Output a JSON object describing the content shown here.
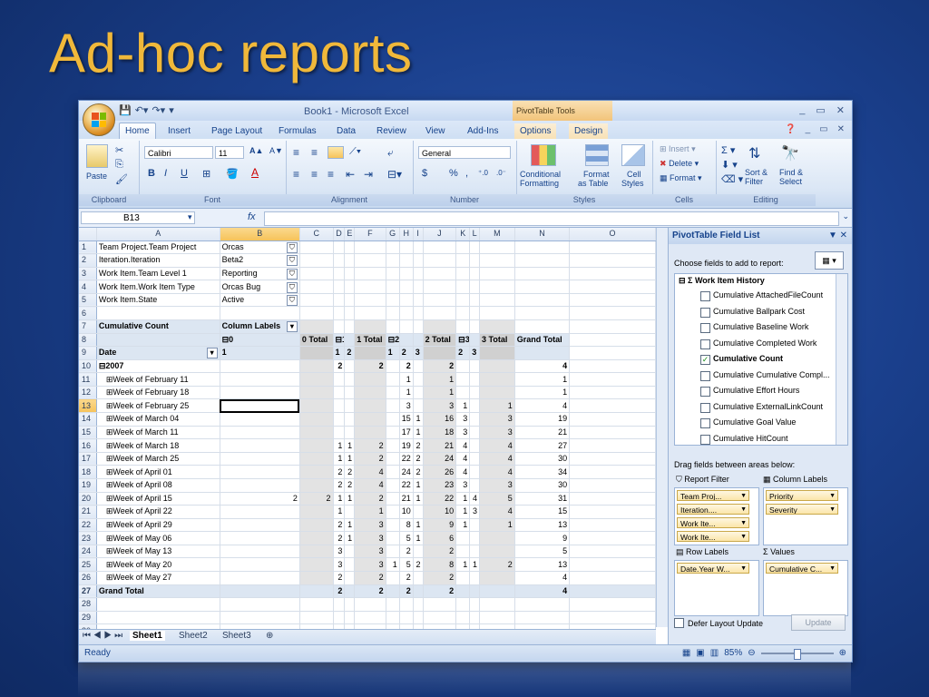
{
  "slide_title": "Ad-hoc reports",
  "window": {
    "title": "Book1 - Microsoft Excel",
    "context_tools": "PivotTable Tools",
    "controls": [
      "_",
      "▭",
      "✕"
    ]
  },
  "tabs": [
    "Home",
    "Insert",
    "Page Layout",
    "Formulas",
    "Data",
    "Review",
    "View",
    "Add-Ins",
    "Options",
    "Design"
  ],
  "ribbon": {
    "clipboard": {
      "label": "Clipboard",
      "paste": "Paste"
    },
    "font": {
      "label": "Font",
      "name": "Calibri",
      "size": "11",
      "bold": "B",
      "italic": "I",
      "underline": "U"
    },
    "alignment": {
      "label": "Alignment"
    },
    "number": {
      "label": "Number",
      "format": "General",
      "currency": "$",
      "percent": "%",
      "comma": ","
    },
    "styles": {
      "label": "Styles",
      "conditional": "Conditional",
      "conditional2": "Formatting",
      "format_table": "Format",
      "format_table2": "as Table",
      "cell_styles": "Cell",
      "cell_styles2": "Styles"
    },
    "cells": {
      "label": "Cells",
      "insert": "Insert",
      "delete": "Delete",
      "format": "Format"
    },
    "editing": {
      "label": "Editing",
      "sort": "Sort &",
      "sort2": "Filter",
      "find": "Find &",
      "find2": "Select"
    }
  },
  "formula_bar": {
    "name_box": "B13",
    "fx": "fx",
    "value": ""
  },
  "columns": [
    "",
    "A",
    "B",
    "C",
    "D",
    "E",
    "F",
    "G",
    "H",
    "I",
    "J",
    "K",
    "L",
    "M",
    "N",
    "O"
  ],
  "filters": [
    {
      "row": "1",
      "label": "Team Project.Team Project",
      "value": "Orcas"
    },
    {
      "row": "2",
      "label": "Iteration.Iteration",
      "value": "Beta2"
    },
    {
      "row": "3",
      "label": "Work Item.Team Level 1",
      "value": "Reporting"
    },
    {
      "row": "4",
      "label": "Work Item.Work Item Type",
      "value": "Orcas Bug"
    },
    {
      "row": "5",
      "label": "Work Item.State",
      "value": "Active"
    }
  ],
  "pivot": {
    "measure": "Cumulative Count",
    "column_labels": "Column Labels",
    "date_label": "Date",
    "p0": "⊟0",
    "p0_1": "1",
    "t0": "0 Total",
    "p1": "⊟1",
    "p1_1": "1",
    "p1_2": "2",
    "t1": "1 Total",
    "p2": "⊟2",
    "p2_1": "1",
    "p2_2": "2",
    "p2_3": "3",
    "t2": "2 Total",
    "p3": "⊟3",
    "p3_2": "2",
    "p3_3": "3",
    "t3": "3 Total",
    "grand": "Grand Total",
    "year": "⊟2007",
    "year_vals": {
      "D": "2",
      "F": "2",
      "H": "2",
      "J": "2",
      "N": "4"
    },
    "rows": [
      {
        "r": "11",
        "label": "⊞Week of February 11",
        "H": "1",
        "J": "1",
        "N": "1"
      },
      {
        "r": "12",
        "label": "⊞Week of February 18",
        "H": "1",
        "J": "1",
        "N": "1"
      },
      {
        "r": "13",
        "label": "⊞Week of February 25",
        "H": "3",
        "J": "3",
        "K": "1",
        "M": "1",
        "N": "4"
      },
      {
        "r": "14",
        "label": "⊞Week of March 04",
        "H": "15",
        "I": "1",
        "J": "16",
        "K": "3",
        "M": "3",
        "N": "19"
      },
      {
        "r": "15",
        "label": "⊞Week of March 11",
        "H": "17",
        "I": "1",
        "J": "18",
        "K": "3",
        "M": "3",
        "N": "21"
      },
      {
        "r": "16",
        "label": "⊞Week of March 18",
        "D": "1",
        "E": "1",
        "F": "2",
        "H": "19",
        "I": "2",
        "J": "21",
        "K": "4",
        "M": "4",
        "N": "27"
      },
      {
        "r": "17",
        "label": "⊞Week of March 25",
        "D": "1",
        "E": "1",
        "F": "2",
        "H": "22",
        "I": "2",
        "J": "24",
        "K": "4",
        "M": "4",
        "N": "30"
      },
      {
        "r": "18",
        "label": "⊞Week of April 01",
        "D": "2",
        "E": "2",
        "F": "4",
        "H": "24",
        "I": "2",
        "J": "26",
        "K": "4",
        "M": "4",
        "N": "34"
      },
      {
        "r": "19",
        "label": "⊞Week of April 08",
        "D": "2",
        "E": "2",
        "F": "4",
        "H": "22",
        "I": "1",
        "J": "23",
        "K": "3",
        "M": "3",
        "N": "30"
      },
      {
        "r": "20",
        "label": "⊞Week of April 15",
        "B": "2",
        "C": "2",
        "D": "1",
        "E": "1",
        "F": "2",
        "H": "21",
        "I": "1",
        "J": "22",
        "K": "1",
        "L": "4",
        "M": "5",
        "N": "31"
      },
      {
        "r": "21",
        "label": "⊞Week of April 22",
        "D": "1",
        "F": "1",
        "H": "10",
        "J": "10",
        "K": "1",
        "L": "3",
        "M": "4",
        "N": "15"
      },
      {
        "r": "22",
        "label": "⊞Week of April 29",
        "D": "2",
        "E": "1",
        "F": "3",
        "H": "8",
        "I": "1",
        "J": "9",
        "K": "1",
        "M": "1",
        "N": "13"
      },
      {
        "r": "23",
        "label": "⊞Week of May 06",
        "D": "2",
        "E": "1",
        "F": "3",
        "H": "5",
        "I": "1",
        "J": "6",
        "N": "9"
      },
      {
        "r": "24",
        "label": "⊞Week of May 13",
        "D": "3",
        "F": "3",
        "H": "2",
        "J": "2",
        "N": "5"
      },
      {
        "r": "25",
        "label": "⊞Week of May 20",
        "D": "3",
        "F": "3",
        "G": "1",
        "H": "5",
        "I": "2",
        "J": "8",
        "K": "1",
        "L": "1",
        "M": "2",
        "N": "13"
      },
      {
        "r": "26",
        "label": "⊞Week of May 27",
        "D": "2",
        "F": "2",
        "H": "2",
        "J": "2",
        "N": "4"
      }
    ],
    "grand_row": {
      "D": "2",
      "F": "2",
      "H": "2",
      "J": "2",
      "N": "4"
    }
  },
  "sheets": [
    "Sheet1",
    "Sheet2",
    "Sheet3"
  ],
  "status": {
    "ready": "Ready",
    "zoom": "85%"
  },
  "field_list": {
    "title": "PivotTable Field List",
    "choose": "Choose fields to add to report:",
    "group": "Work Item History",
    "fields": [
      {
        "name": "Cumulative AttachedFileCount",
        "checked": false
      },
      {
        "name": "Cumulative Ballpark Cost",
        "checked": false
      },
      {
        "name": "Cumulative Baseline Work",
        "checked": false
      },
      {
        "name": "Cumulative Completed Work",
        "checked": false
      },
      {
        "name": "Cumulative Count",
        "checked": true
      },
      {
        "name": "Cumulative Cumulative Compl...",
        "checked": false
      },
      {
        "name": "Cumulative Effort Hours",
        "checked": false
      },
      {
        "name": "Cumulative ExternalLinkCount",
        "checked": false
      },
      {
        "name": "Cumulative Goal Value",
        "checked": false
      },
      {
        "name": "Cumulative HitCount",
        "checked": false
      }
    ],
    "drag_label": "Drag fields between areas below:",
    "report_filter": "Report Filter",
    "column_labels": "Column Labels",
    "row_labels": "Row Labels",
    "values": "Values",
    "report_filter_items": [
      "Team Proj...",
      "Iteration....",
      "Work Ite...",
      "Work Ite..."
    ],
    "column_items": [
      "Priority",
      "Severity"
    ],
    "row_items": [
      "Date.Year W..."
    ],
    "value_items": [
      "Cumulative C..."
    ],
    "defer": "Defer Layout Update",
    "update": "Update"
  }
}
